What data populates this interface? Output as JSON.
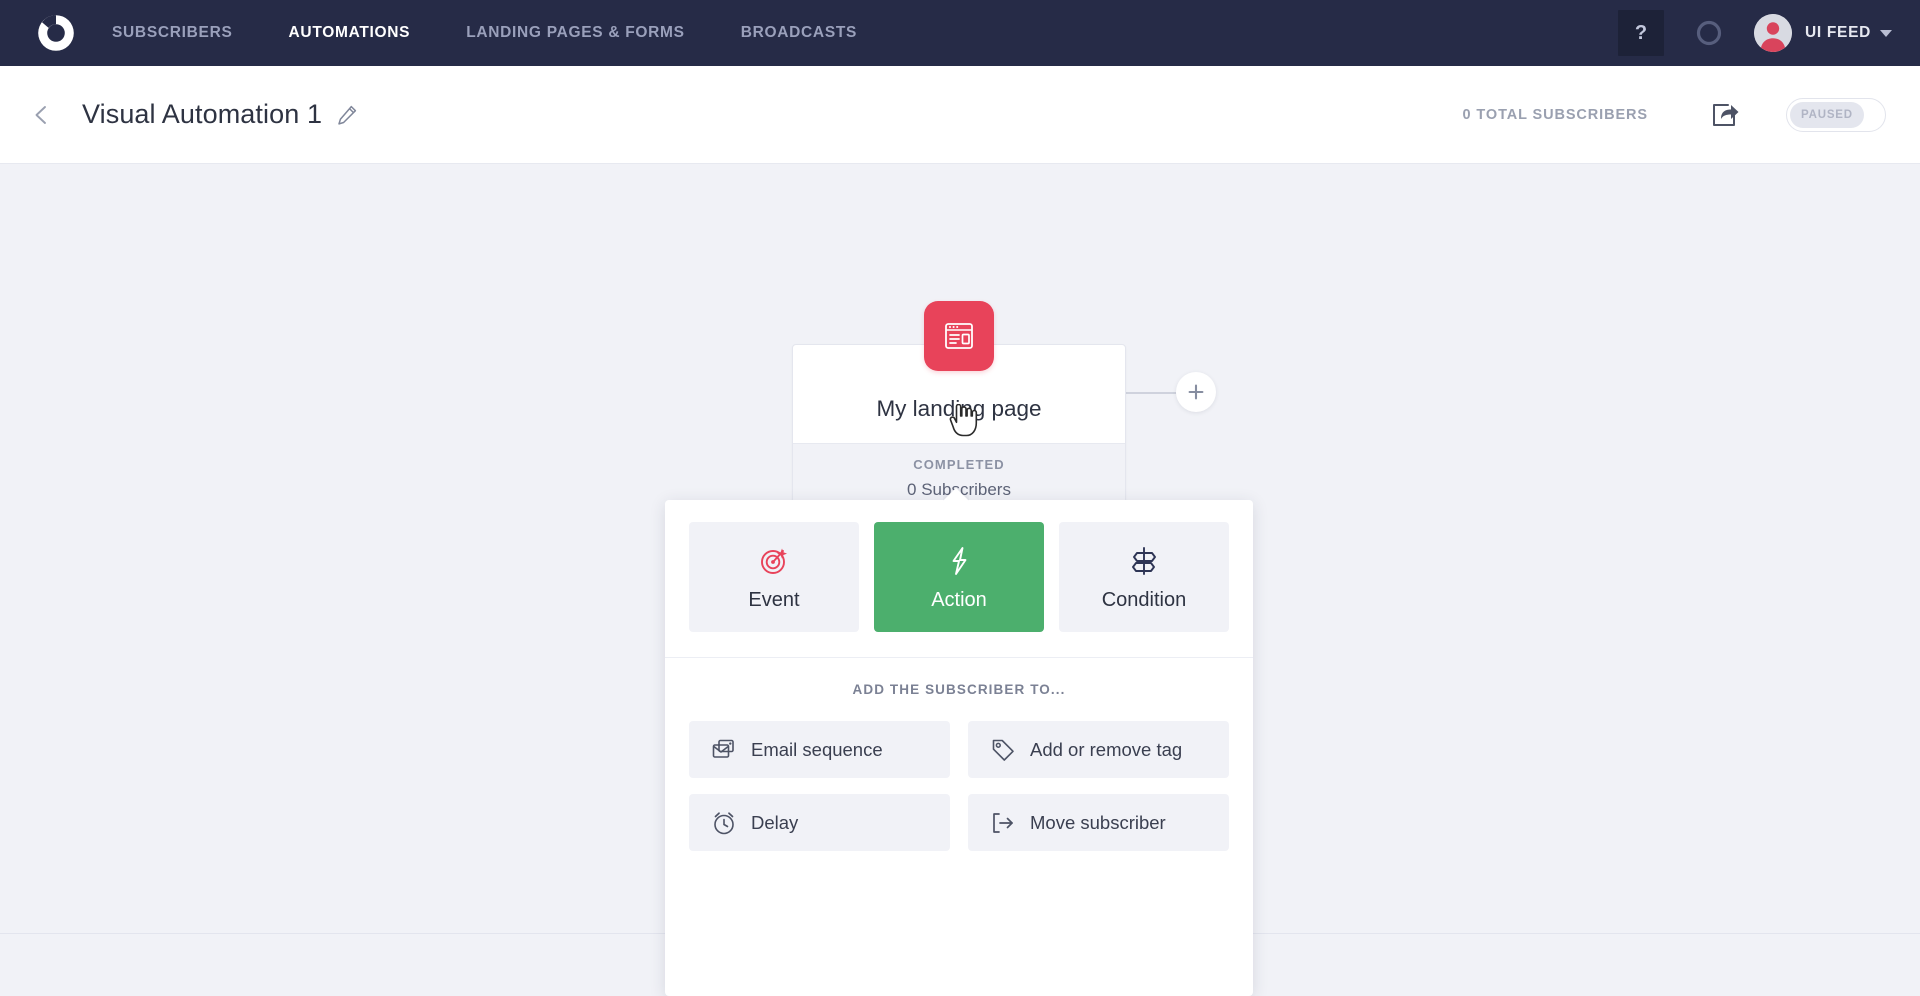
{
  "nav": {
    "logo_icon": "convertkit-logo-icon",
    "links": [
      {
        "label": "SUBSCRIBERS",
        "active": false
      },
      {
        "label": "AUTOMATIONS",
        "active": true
      },
      {
        "label": "LANDING PAGES & FORMS",
        "active": false
      },
      {
        "label": "BROADCASTS",
        "active": false
      }
    ],
    "help_label": "?",
    "notification_icon": "circle-icon",
    "avatar_icon": "user-avatar-icon",
    "user_name": "UI FEED",
    "caret_icon": "chevron-down-icon",
    "bg_color": "#262b47",
    "active_color": "#ffffff",
    "muted_color": "#9aa0bb"
  },
  "subheader": {
    "back_icon": "chevron-left-icon",
    "title": "Visual Automation 1",
    "edit_icon": "pencil-icon",
    "total_subscribers": "0 TOTAL SUBSCRIBERS",
    "share_icon": "share-icon",
    "toggle_state": "PAUSED"
  },
  "canvas": {
    "node": {
      "icon": "landing-page-icon",
      "icon_color": "#e8435a",
      "title": "My landing page",
      "status": "COMPLETED",
      "subscribers": "0 Subscribers"
    },
    "add_right_label": "+",
    "add_below_label": "+"
  },
  "popup": {
    "tabs": [
      {
        "label": "Event",
        "icon": "target-icon",
        "active": false
      },
      {
        "label": "Action",
        "icon": "lightning-bolt-icon",
        "active": true
      },
      {
        "label": "Condition",
        "icon": "signpost-icon",
        "active": false
      }
    ],
    "active_tab_color": "#4caf6d",
    "menu_heading": "ADD THE SUBSCRIBER TO...",
    "menu_items": [
      {
        "label": "Email sequence",
        "icon": "email-sequence-icon"
      },
      {
        "label": "Add or remove tag",
        "icon": "tag-icon"
      },
      {
        "label": "Delay",
        "icon": "alarm-clock-icon"
      },
      {
        "label": "Move subscriber",
        "icon": "move-subscriber-icon"
      }
    ]
  },
  "cursor": {
    "icon": "pointer-hand-icon"
  }
}
